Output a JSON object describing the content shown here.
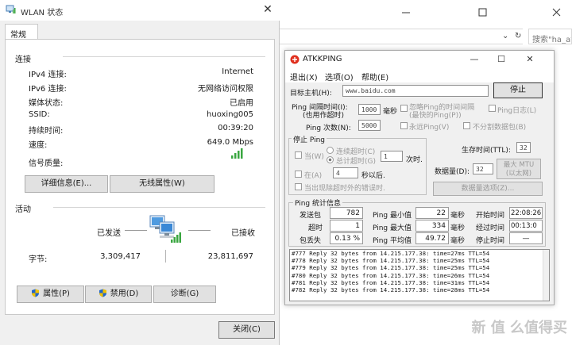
{
  "background_window": {
    "search_placeholder": "搜索\"ha_at",
    "dropdown_glyph": "⌄",
    "refresh_glyph": "↻"
  },
  "wlan_dialog": {
    "title": "WLAN 状态",
    "close_glyph": "✕",
    "tab": "常规",
    "connection": {
      "section_title": "连接",
      "rows": [
        {
          "label": "IPv4 连接:",
          "value": "Internet"
        },
        {
          "label": "IPv6 连接:",
          "value": "无网络访问权限"
        },
        {
          "label": "媒体状态:",
          "value": "已启用"
        },
        {
          "label": "SSID:",
          "value": "huoxing005"
        },
        {
          "label": "持续时间:",
          "value": "00:39:20"
        },
        {
          "label": "速度:",
          "value": "649.0 Mbps"
        }
      ],
      "signal_label": "信号质量:",
      "details_button": "详细信息(E)...",
      "wireless_props_button": "无线属性(W)"
    },
    "activity": {
      "section_title": "活动",
      "sent_label": "已发送",
      "received_label": "已接收",
      "bytes_label": "字节:",
      "bytes_sent": "3,309,417",
      "bytes_received": "23,811,697"
    },
    "buttons": {
      "properties": "属性(P)",
      "disable": "禁用(D)",
      "diagnose": "诊断(G)",
      "close": "关闭(C)"
    }
  },
  "atkkping": {
    "title": "ATKKPING",
    "controls": {
      "minimize": "—",
      "maximize": "☐",
      "close": "✕"
    },
    "menu": [
      "退出(X)",
      "选项(O)",
      "帮助(E)"
    ],
    "target_label": "目标主机(H):",
    "target_value": "www.baidu.com",
    "stop_button": "停止",
    "interval_label_1": "Ping 间隔时间(I):",
    "interval_label_2": "(也用作超时)",
    "interval_value": "1000",
    "interval_unit": "毫秒",
    "ignore_label_1": "忽略Ping的时间间隔",
    "ignore_label_2": "(最快的Ping(P))",
    "ping_log_label": "Ping日志(L)",
    "count_label": "Ping 次数(N):",
    "count_value": "5000",
    "forever_label": "永远Ping(V)",
    "no_fragment_label": "不分割数据包(B)",
    "stop_group": {
      "title": "停止 Ping",
      "when_label": "当(W)",
      "consecutive_label": "连续超时(C)",
      "total_label": "总计超时(G)",
      "timeouts_value": "1",
      "times_unit": "次时.",
      "at_label": "在(A)",
      "at_value": "4",
      "seconds_after": "秒以后.",
      "error_label": "当出现除超时外的错误时."
    },
    "ttl_label": "生存时间(TTL):",
    "ttl_value": "32",
    "size_label": "数据量(D):",
    "size_value": "32",
    "max_mtu_label_1": "最大 MTU",
    "max_mtu_label_2": "(以太网)",
    "data_options_button": "数据量选项(Z)...",
    "stats": {
      "title": "Ping 统计信息",
      "sent_label": "发送包",
      "sent_value": "782",
      "timeout_label": "超时",
      "timeout_value": "1",
      "loss_label": "包丢失",
      "loss_value": "0.13 %",
      "min_label": "Ping 最小值",
      "min_value": "22",
      "max_label": "Ping 最大值",
      "max_value": "334",
      "avg_label": "Ping 平均值",
      "avg_value": "49.72",
      "ms_unit": "毫秒",
      "start_label": "开始时间",
      "start_value": "22:08:26",
      "elapsed_label": "经过时间",
      "elapsed_value": "00:13:0",
      "stop_time_label": "停止时间",
      "stop_time_value": "—"
    },
    "log_lines": [
      "#777 Reply 32 bytes from 14.215.177.38: time=27ms TTL=54",
      "#778 Reply 32 bytes from 14.215.177.38: time=25ms TTL=54",
      "#779 Reply 32 bytes from 14.215.177.38: time=25ms TTL=54",
      "#780 Reply 32 bytes from 14.215.177.38: time=26ms TTL=54",
      "#781 Reply 32 bytes from 14.215.177.38: time=31ms TTL=54",
      "#782 Reply 32 bytes from 14.215.177.38: time=28ms TTL=54"
    ]
  },
  "watermark": "新 值 么值得买",
  "colors": {
    "accent": "#2a7bd3",
    "signal_green": "#3aa640",
    "shield_blue": "#2266cc",
    "shield_yellow": "#f2c200"
  }
}
